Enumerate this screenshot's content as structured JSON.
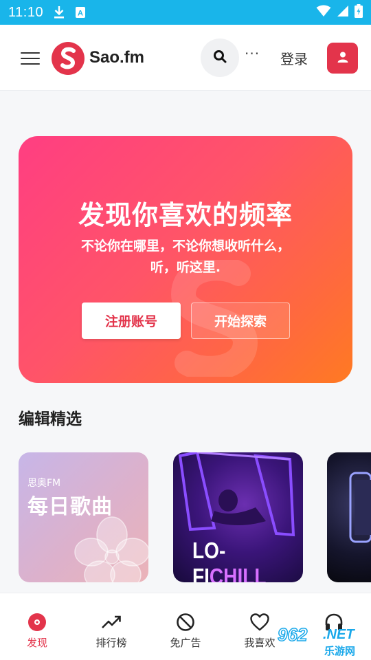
{
  "status_bar": {
    "time": "11:10",
    "icons": [
      "download-icon",
      "text-box-icon",
      "wifi-icon",
      "cellular-signal-icon",
      "battery-icon"
    ],
    "background": "#19b5ea"
  },
  "header": {
    "brand": "Sao.fm",
    "more_label": "···",
    "login_label": "登录",
    "accent": "#e3344b"
  },
  "hero": {
    "title": "发现你喜欢的频率",
    "subtitle_line1": "不论你在哪里，不论你想收听什么，",
    "subtitle_line2": "听，听这里.",
    "register_label": "注册账号",
    "explore_label": "开始探索"
  },
  "picks": {
    "section_title": "编辑精选",
    "cards": [
      {
        "small": "思奥FM",
        "big": "每日歌曲"
      },
      {
        "part1": "LO-FI",
        "part2": "CHILL"
      },
      {}
    ]
  },
  "bottom_nav": {
    "items": [
      {
        "label": "发现",
        "icon": "disc-icon",
        "active": true
      },
      {
        "label": "排行榜",
        "icon": "trending-icon",
        "active": false
      },
      {
        "label": "免广告",
        "icon": "block-icon",
        "active": false
      },
      {
        "label": "我喜欢",
        "icon": "heart-icon",
        "active": false
      },
      {
        "label": "",
        "icon": "headphones-icon",
        "active": false
      }
    ]
  },
  "watermark": {
    "number": "962",
    "suffix": ".NET",
    "sub": "乐游网"
  }
}
